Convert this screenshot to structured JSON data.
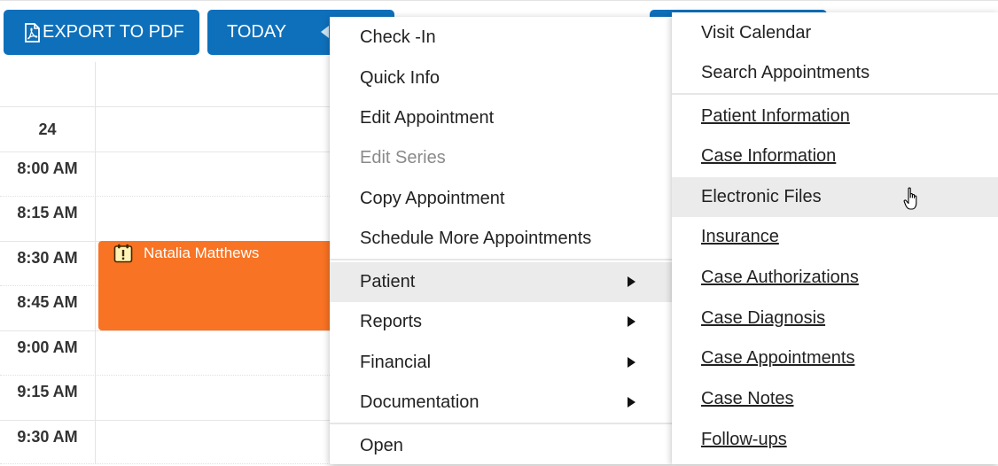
{
  "toolbar": {
    "export_label": "EXPORT TO PDF",
    "today_label": "TODAY"
  },
  "calendar": {
    "day_number": "24",
    "times": [
      "8:00 AM",
      "8:15 AM",
      "8:30 AM",
      "8:45 AM",
      "9:00 AM",
      "9:15 AM",
      "9:30 AM"
    ],
    "appointment": {
      "patient_name": "Natalia Matthews",
      "color": "#f87323"
    }
  },
  "context_menu": {
    "items": [
      {
        "label": "Check -In"
      },
      {
        "label": "Quick Info"
      },
      {
        "label": "Edit Appointment"
      },
      {
        "label": "Edit Series",
        "disabled": true
      },
      {
        "label": "Copy Appointment"
      },
      {
        "label": "Schedule More Appointments"
      },
      {
        "label": "Patient",
        "submenu": true,
        "hovered": true
      },
      {
        "label": "Reports",
        "submenu": true
      },
      {
        "label": "Financial",
        "submenu": true
      },
      {
        "label": "Documentation",
        "submenu": true
      },
      {
        "label": "Open"
      }
    ]
  },
  "patient_submenu": {
    "items": [
      {
        "label": "Visit Calendar"
      },
      {
        "label": "Search Appointments"
      },
      {
        "label": "Patient Information",
        "link": true
      },
      {
        "label": "Case Information",
        "link": true
      },
      {
        "label": "Electronic Files",
        "hovered": true
      },
      {
        "label": "Insurance",
        "link": true
      },
      {
        "label": "Case Authorizations",
        "link": true
      },
      {
        "label": "Case Diagnosis",
        "link": true
      },
      {
        "label": "Case Appointments",
        "link": true
      },
      {
        "label": "Case Notes",
        "link": true
      },
      {
        "label": "Follow-ups",
        "link": true
      }
    ]
  },
  "colors": {
    "primary_button": "#0e70bb",
    "menu_hover": "#ebebeb"
  }
}
